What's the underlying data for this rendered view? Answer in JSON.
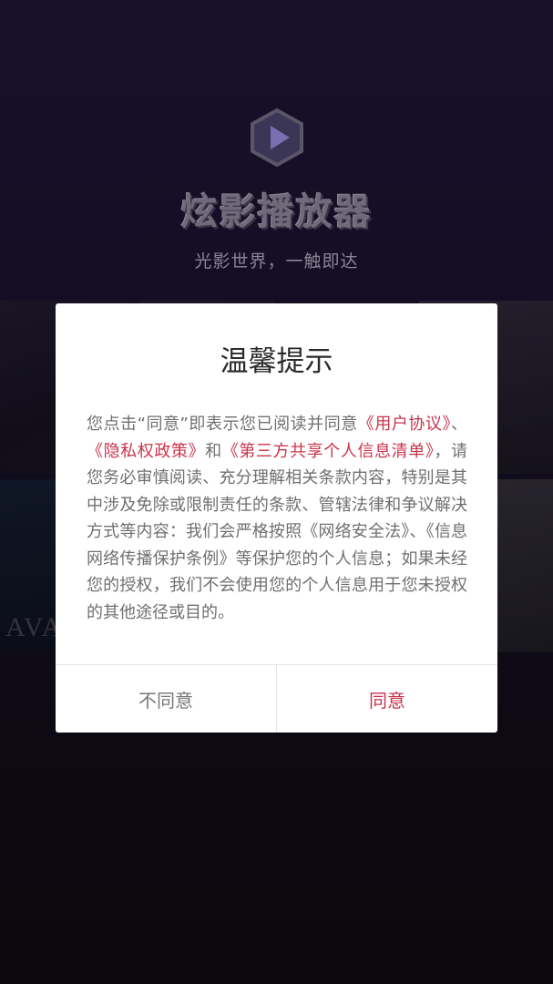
{
  "app": {
    "name": "炫影播放器",
    "slogan": "光影世界，一触即达"
  },
  "background_posters": [
    {
      "text": ""
    },
    {
      "text": ""
    },
    {
      "text": ""
    },
    {
      "text": ""
    },
    {
      "text": "AVATAR"
    },
    {
      "text": ""
    },
    {
      "text": ""
    },
    {
      "text": ""
    }
  ],
  "dialog": {
    "title": "温馨提示",
    "body": {
      "intro": "您点击“同意”即表示您已阅读并同意",
      "link_user_agreement": "《用户协议》",
      "sep1": "、",
      "link_privacy_policy": "《隐私权政策》",
      "and": "和",
      "link_third_party": "《第三方共享个人信息清单》",
      "rest": "，请您务必审慎阅读、充分理解相关条款内容，特别是其中涉及免除或限制责任的条款、管辖法律和争议解决方式等内容：我们会严格按照《网络安全法》、《信息网络传播保护条例》等保护您的个人信息；如果未经您的授权，我们不会使用您的个人信息用于您未授权的其他途径或目的。"
    },
    "buttons": {
      "disagree": "不同意",
      "agree": "同意"
    }
  },
  "colors": {
    "accent": "#c8344b",
    "background_top": "#2c1f4e"
  },
  "icons": {
    "logo": "hexagon-play-icon"
  }
}
